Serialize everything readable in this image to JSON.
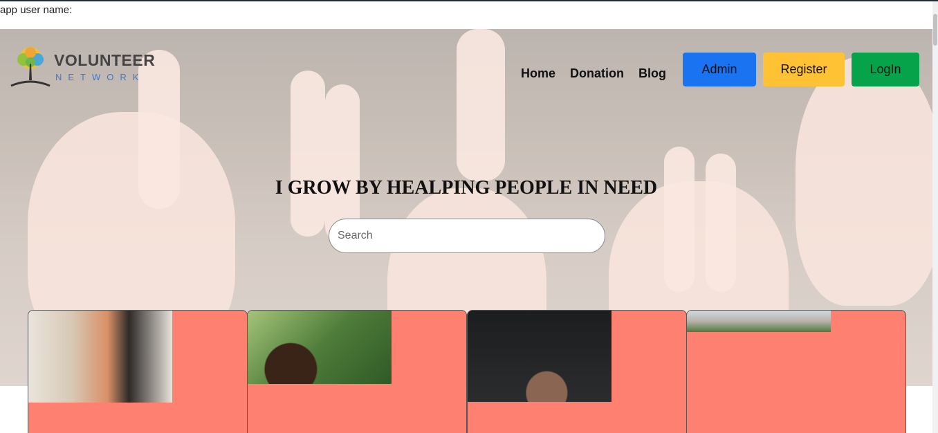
{
  "app": {
    "username_label": "app user name:"
  },
  "logo": {
    "word1": "VOLUNTEER",
    "word2": "NETWORK"
  },
  "nav": {
    "items": [
      {
        "label": "Home"
      },
      {
        "label": "Donation"
      },
      {
        "label": "Blog"
      }
    ]
  },
  "buttons": {
    "admin": "Admin",
    "register": "Register",
    "login": "LogIn"
  },
  "hero": {
    "headline": "I GROW BY HEALPING PEOPLE IN NEED",
    "search_placeholder": "Search"
  },
  "colors": {
    "admin": "#1a73f0",
    "register": "#ffc234",
    "login": "#07a34b",
    "card": "#fd8070",
    "network_text": "#3a7bd5"
  },
  "cards": [
    {
      "image": "clothes-rack-photo"
    },
    {
      "image": "girl-outdoors-photo"
    },
    {
      "image": "water-hands-photo"
    },
    {
      "image": "city-buildings-photo"
    }
  ]
}
